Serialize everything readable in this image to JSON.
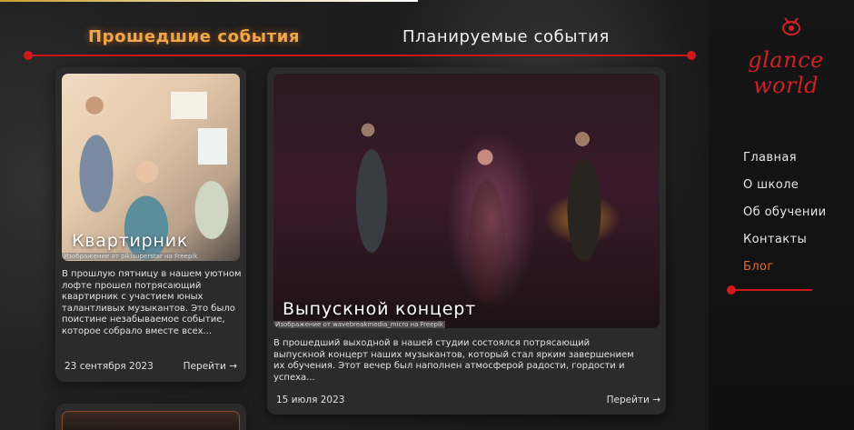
{
  "tabs": {
    "past": "Прошедшие события",
    "planned": "Планируемые события"
  },
  "logo": {
    "text": "glance world"
  },
  "nav": {
    "items": [
      "Главная",
      "О школе",
      "Об обучении",
      "Контакты",
      "Блог"
    ],
    "active": "Блог"
  },
  "events": [
    {
      "title": "Квартирник",
      "credit": "Изображение от pikisuperstar на Freepik",
      "description": "В прошлую пятницу в нашем уютном лофте прошел потрясающий квартирник с участием юных талантливых музыкантов. Это было поистине незабываемое событие, которое собрало вместе всех...",
      "date": "23 сентября 2023",
      "more": "Перейти →"
    },
    {
      "title": "Выпускной концерт",
      "credit": "Изображение от wavebreakmedia_micro на Freepik",
      "description": "В прошедший выходной в нашей студии состоялся потрясающий выпускной концерт наших музыкантов, который стал ярким завершением их обучения. Этот вечер был наполнен атмосферой радости, гордости и успеха...",
      "date": "15 июля 2023",
      "more": "Перейти →"
    }
  ],
  "colors": {
    "accent_red": "#c8171c",
    "active_orange": "#f0a64a",
    "background": "#1b1b1b",
    "card": "#2b2b2b"
  }
}
